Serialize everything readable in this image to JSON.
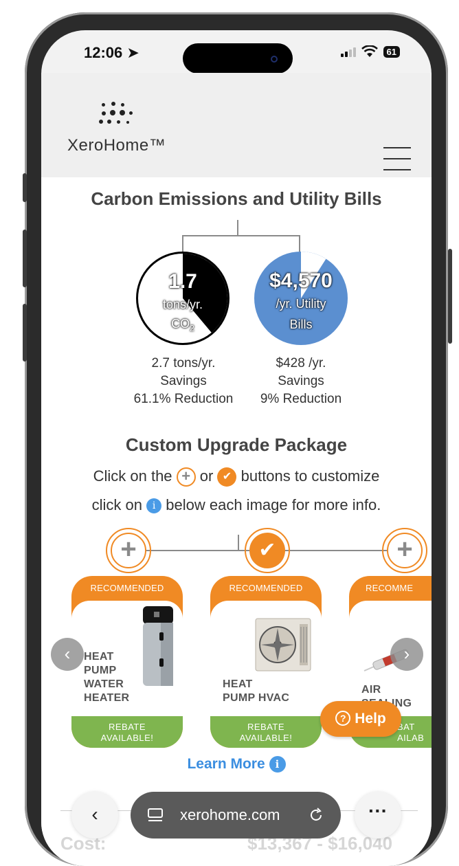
{
  "status_bar": {
    "time": "12:06",
    "battery": "61"
  },
  "header": {
    "logo_text": "XeroHome™",
    "menu_icon": "hamburger-menu-icon"
  },
  "carbon_section": {
    "title": "Carbon Emissions and Utility Bills",
    "co2": {
      "value": "1.7",
      "unit_line1": "tons/yr.",
      "unit_line2": "CO",
      "sub": "2",
      "savings": "2.7 tons/yr.",
      "savings_label": "Savings",
      "reduction": "61.1% Reduction",
      "reduction_fraction": 0.611
    },
    "utility": {
      "value": "$4,570",
      "unit_line1": "/yr. Utility",
      "unit_line2": "Bills",
      "savings": "$428 /yr.",
      "savings_label": "Savings",
      "reduction": "9% Reduction",
      "reduction_fraction": 0.09
    }
  },
  "upgrade_section": {
    "title": "Custom Upgrade Package",
    "line1_pre": "Click on the",
    "line1_mid": "or",
    "line1_post": "buttons to customize",
    "line2_pre": "click on",
    "line2_post": "below each image for more info.",
    "cards": [
      {
        "badge": "RECOMMENDED",
        "name_lines": [
          "HEAT",
          "PUMP",
          "WATER",
          "HEATER"
        ],
        "rebate": [
          "REBATE",
          "AVAILABLE!"
        ],
        "selected": false
      },
      {
        "badge": "RECOMMENDED",
        "name_lines": [
          "HEAT",
          "PUMP HVAC"
        ],
        "rebate": [
          "REBATE",
          "AVAILABLE!"
        ],
        "selected": true
      },
      {
        "badge": "RECOMME",
        "name_lines": [
          "AIR",
          "SEALING"
        ],
        "rebate": [
          "BAT",
          "AILAB"
        ],
        "selected": false
      }
    ],
    "learn_more": "Learn More",
    "help": "Help"
  },
  "cost": {
    "label": "Cost:",
    "value": "$13,367 - $16,040"
  },
  "browser": {
    "url": "xerohome.com",
    "back_icon": "chevron-left-icon",
    "more_icon": "more-dots-icon"
  },
  "colors": {
    "accent_orange": "#f08a24",
    "green": "#7fb54f",
    "blue": "#5b8fd0",
    "link_blue": "#3b8ee0"
  }
}
